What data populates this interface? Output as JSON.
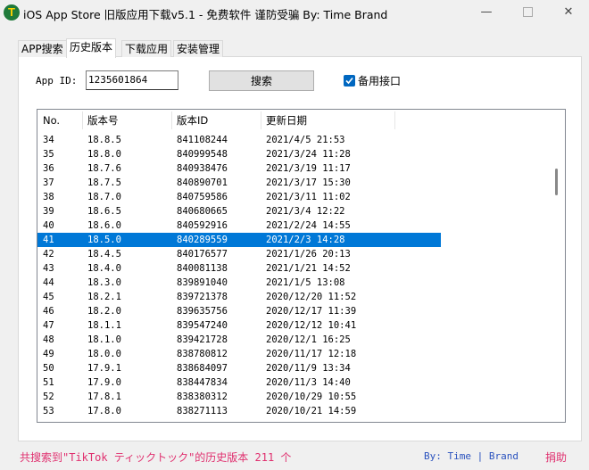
{
  "window": {
    "title": "iOS App Store 旧版应用下载v5.1 - 免费软件 谨防受骗 By: Time Brand",
    "icon_glyph": "T",
    "controls": {
      "minimize": "—",
      "close": "✕"
    }
  },
  "tabs": [
    {
      "label": "APP搜索",
      "active": false
    },
    {
      "label": "历史版本",
      "active": true
    },
    {
      "label": "下载应用",
      "active": false
    },
    {
      "label": "安装管理",
      "active": false
    }
  ],
  "form": {
    "appid_label": "App ID:",
    "appid_value": "1235601864",
    "search_label": "搜索",
    "backup_label": "备用接口",
    "backup_checked": true
  },
  "list": {
    "columns": [
      "No.",
      "版本号",
      "版本ID",
      "更新日期"
    ],
    "selected_index": 7,
    "rows": [
      [
        "34",
        "18.8.5",
        "841108244",
        "2021/4/5 21:53"
      ],
      [
        "35",
        "18.8.0",
        "840999548",
        "2021/3/24 11:28"
      ],
      [
        "36",
        "18.7.6",
        "840938476",
        "2021/3/19 11:17"
      ],
      [
        "37",
        "18.7.5",
        "840890701",
        "2021/3/17 15:30"
      ],
      [
        "38",
        "18.7.0",
        "840759586",
        "2021/3/11 11:02"
      ],
      [
        "39",
        "18.6.5",
        "840680665",
        "2021/3/4 12:22"
      ],
      [
        "40",
        "18.6.0",
        "840592916",
        "2021/2/24 14:55"
      ],
      [
        "41",
        "18.5.0",
        "840289559",
        "2021/2/3 14:28"
      ],
      [
        "42",
        "18.4.5",
        "840176577",
        "2021/1/26 20:13"
      ],
      [
        "43",
        "18.4.0",
        "840081138",
        "2021/1/21 14:52"
      ],
      [
        "44",
        "18.3.0",
        "839891040",
        "2021/1/5 13:08"
      ],
      [
        "45",
        "18.2.1",
        "839721378",
        "2020/12/20 11:52"
      ],
      [
        "46",
        "18.2.0",
        "839635756",
        "2020/12/17 11:39"
      ],
      [
        "47",
        "18.1.1",
        "839547240",
        "2020/12/12 10:41"
      ],
      [
        "48",
        "18.1.0",
        "839421728",
        "2020/12/1 16:25"
      ],
      [
        "49",
        "18.0.0",
        "838780812",
        "2020/11/17 12:18"
      ],
      [
        "50",
        "17.9.1",
        "838684097",
        "2020/11/9 13:34"
      ],
      [
        "51",
        "17.9.0",
        "838447834",
        "2020/11/3 14:40"
      ],
      [
        "52",
        "17.8.1",
        "838380312",
        "2020/10/29 10:55"
      ],
      [
        "53",
        "17.8.0",
        "838271113",
        "2020/10/21 14:59"
      ]
    ]
  },
  "footer": {
    "status": "共搜索到\"TikTok ティックトック\"的历史版本 211 个",
    "by": "By: Time | Brand",
    "donate": "捐助"
  },
  "colors": {
    "accent": "#0078d7",
    "status_pink": "#e0306f",
    "by_blue": "#2a52be",
    "icon_green": "#1f7a3a"
  }
}
